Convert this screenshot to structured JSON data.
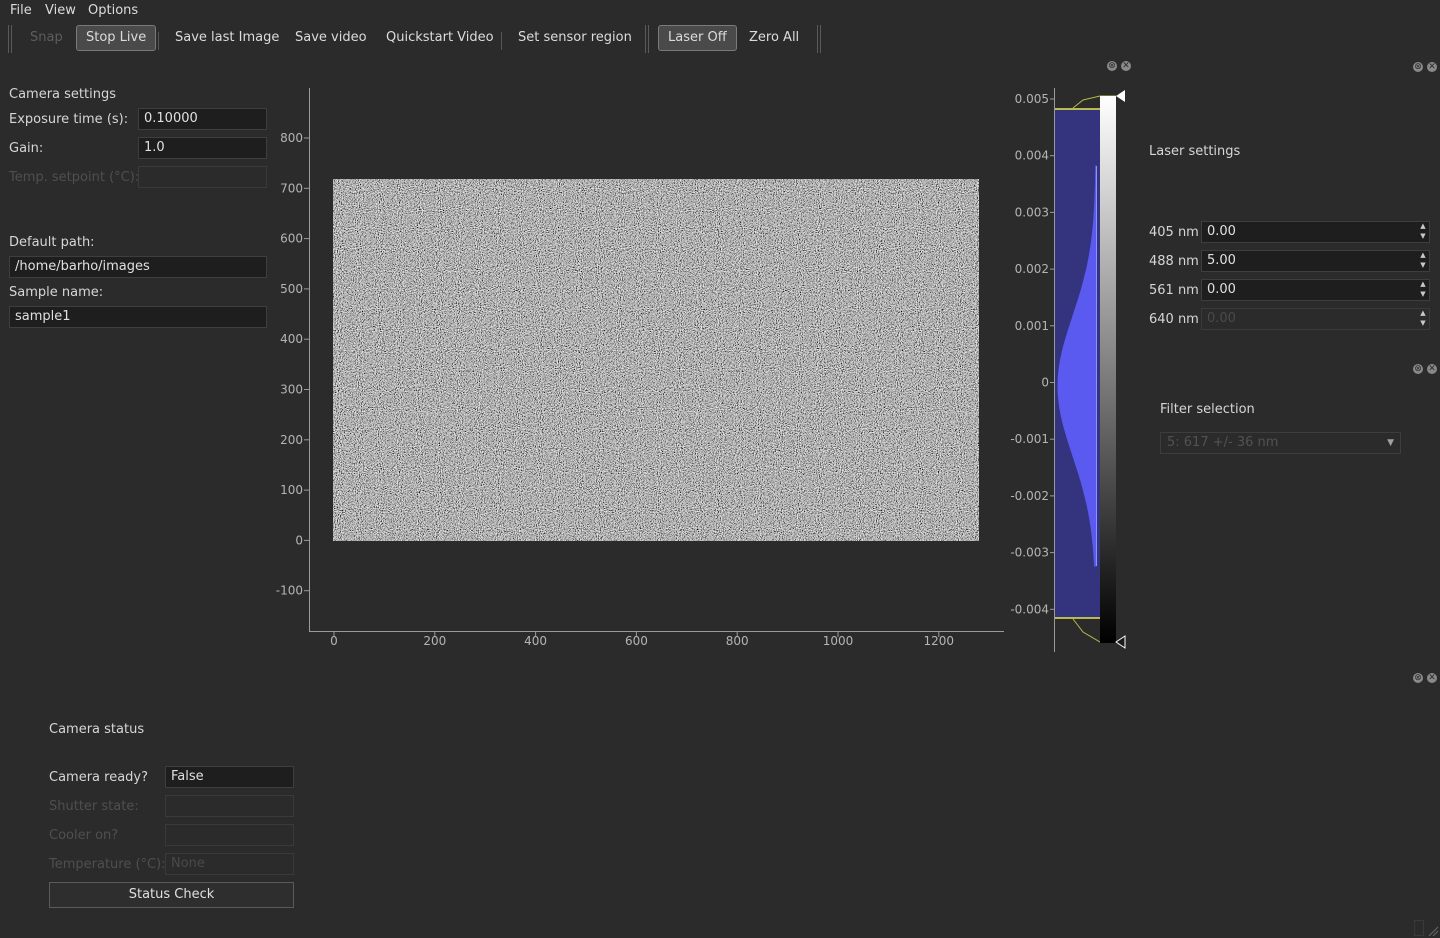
{
  "menu": {
    "file": "File",
    "view": "View",
    "options": "Options"
  },
  "toolbar": {
    "snap": "Snap",
    "stop_live": "Stop Live",
    "save_last_image": "Save last Image",
    "save_video": "Save video",
    "quickstart_video": "Quickstart Video",
    "set_sensor_region": "Set sensor region",
    "laser_off": "Laser Off",
    "zero_all": "Zero All"
  },
  "camera_settings": {
    "title": "Camera settings",
    "exposure_label": "Exposure time (s):",
    "exposure_value": "0.10000",
    "gain_label": "Gain:",
    "gain_value": "1.0",
    "temp_label": "Temp. setpoint (°C):",
    "temp_value": "",
    "default_path_label": "Default path:",
    "default_path_value": "/home/barho/images",
    "sample_name_label": "Sample name:",
    "sample_name_value": "sample1"
  },
  "image_view": {
    "y_ticks": [
      "800",
      "700",
      "600",
      "500",
      "400",
      "300",
      "200",
      "100",
      "0",
      "-100"
    ],
    "x_ticks": [
      "0",
      "200",
      "400",
      "600",
      "800",
      "1000",
      "1200"
    ]
  },
  "histogram": {
    "ticks": [
      "0.005",
      "0.004",
      "0.003",
      "0.002",
      "0.001",
      "0",
      "-0.001",
      "-0.002",
      "-0.003",
      "-0.004"
    ],
    "fill_color": "#3434a0",
    "histogram_color": "#5a5af0"
  },
  "laser_settings": {
    "title": "Laser settings",
    "rows": [
      {
        "label": "405 nm",
        "value": "0.00",
        "enabled": true
      },
      {
        "label": "488 nm",
        "value": "5.00",
        "enabled": true
      },
      {
        "label": "561 nm",
        "value": "0.00",
        "enabled": true
      },
      {
        "label": "640 nm",
        "value": "0.00",
        "enabled": false
      }
    ]
  },
  "filter": {
    "title": "Filter selection",
    "selected": "5: 617 +/- 36 nm"
  },
  "camera_status": {
    "title": "Camera status",
    "ready_label": "Camera ready?",
    "ready_value": "False",
    "shutter_label": "Shutter state:",
    "shutter_value": "",
    "cooler_label": "Cooler on?",
    "cooler_value": "",
    "temperature_label": "Temperature (°C):",
    "temperature_value": "None",
    "status_check": "Status Check"
  },
  "colors": {
    "background": "#2b2b2b",
    "field": "#1e1e1e",
    "histogram_region": "#3434a0",
    "histogram_line": "#5a5af0",
    "level_marker": "#e8e84a"
  }
}
